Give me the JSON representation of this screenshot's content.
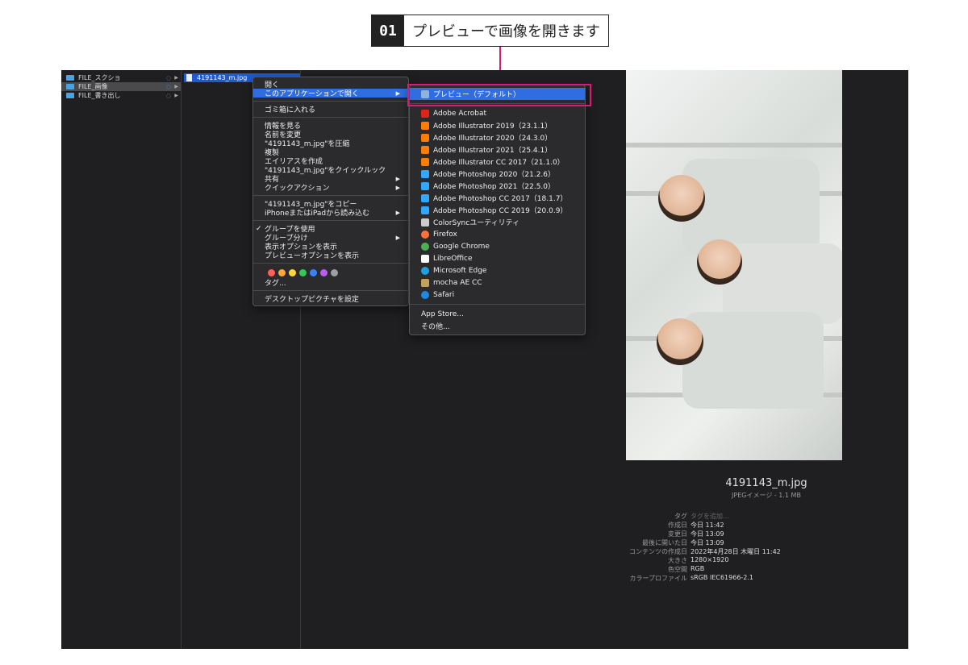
{
  "annotation": {
    "step_number": "01",
    "step_text": "プレビューで画像を開きます"
  },
  "sidebar": {
    "folders": [
      {
        "name": "FILE_スクショ",
        "selected": false
      },
      {
        "name": "FILE_画像",
        "selected": true
      },
      {
        "name": "FILE_書き出し",
        "selected": false
      }
    ]
  },
  "selected_file": {
    "name": "4191143_m.jpg"
  },
  "context_menu": {
    "open": "開く",
    "open_with": "このアプリケーションで開く",
    "trash": "ゴミ箱に入れる",
    "get_info": "情報を見る",
    "rename": "名前を変更",
    "compress": "\"4191143_m.jpg\"を圧縮",
    "duplicate": "複製",
    "alias": "エイリアスを作成",
    "quicklook": "\"4191143_m.jpg\"をクイックルック",
    "share": "共有",
    "quick_actions": "クイックアクション",
    "copy": "\"4191143_m.jpg\"をコピー",
    "import_iphone": "iPhoneまたはiPadから読み込む",
    "use_groups": "グループを使用",
    "group_by": "グループ分け",
    "view_options": "表示オプションを表示",
    "preview_options": "プレビューオプションを表示",
    "tag_colors": [
      "#ff5f57",
      "#ffa53b",
      "#ffd53b",
      "#35c759",
      "#3b82f6",
      "#bf5af2",
      "#9e9ea3"
    ],
    "tags": "タグ...",
    "desktop_picture": "デスクトップピクチャを設定"
  },
  "open_with_menu": {
    "apps": [
      {
        "label": "プレビュー（デフォルト）",
        "icon": "preview-icon",
        "color": "#8fb4d9",
        "active": true
      },
      {
        "label": "Adobe Acrobat",
        "icon": "acrobat-icon",
        "color": "#e2231a"
      },
      {
        "label": "Adobe Illustrator 2019（23.1.1）",
        "icon": "illustrator-icon",
        "color": "#ff7c00"
      },
      {
        "label": "Adobe Illustrator 2020（24.3.0）",
        "icon": "illustrator-icon",
        "color": "#ff7c00"
      },
      {
        "label": "Adobe Illustrator 2021（25.4.1）",
        "icon": "illustrator-icon",
        "color": "#ff7c00"
      },
      {
        "label": "Adobe Illustrator CC 2017（21.1.0）",
        "icon": "illustrator-icon",
        "color": "#ff7c00"
      },
      {
        "label": "Adobe Photoshop 2020（21.2.6）",
        "icon": "photoshop-icon",
        "color": "#31a8ff"
      },
      {
        "label": "Adobe Photoshop 2021（22.5.0）",
        "icon": "photoshop-icon",
        "color": "#31a8ff"
      },
      {
        "label": "Adobe Photoshop CC 2017（18.1.7）",
        "icon": "photoshop-icon",
        "color": "#31a8ff"
      },
      {
        "label": "Adobe Photoshop CC 2019（20.0.9）",
        "icon": "photoshop-icon",
        "color": "#31a8ff"
      },
      {
        "label": "ColorSyncユーティリティ",
        "icon": "colorsync-icon",
        "color": "#cccccc"
      },
      {
        "label": "Firefox",
        "icon": "firefox-icon",
        "color": "#ff7139"
      },
      {
        "label": "Google Chrome",
        "icon": "chrome-icon",
        "color": "#4caf50"
      },
      {
        "label": "LibreOffice",
        "icon": "libreoffice-icon",
        "color": "#ffffff"
      },
      {
        "label": "Microsoft Edge",
        "icon": "edge-icon",
        "color": "#1fa0e0"
      },
      {
        "label": "mocha AE CC",
        "icon": "mocha-icon",
        "color": "#c2a15b"
      },
      {
        "label": "Safari",
        "icon": "safari-icon",
        "color": "#1e88e5"
      }
    ],
    "app_store": "App Store...",
    "other": "その他..."
  },
  "preview": {
    "file_name": "4191143_m.jpg",
    "file_kind": "JPEGイメージ - 1.1 MB",
    "metadata": [
      {
        "key": "タグ",
        "value": "タグを追加...",
        "muted": true
      },
      {
        "key": "作成日",
        "value": "今日 11:42"
      },
      {
        "key": "変更日",
        "value": "今日 13:09"
      },
      {
        "key": "最後に開いた日",
        "value": "今日 13:09"
      },
      {
        "key": "コンテンツの作成日",
        "value": "2022年4月28日 木曜日 11:42"
      },
      {
        "key": "大きさ",
        "value": "1280×1920"
      },
      {
        "key": "色空間",
        "value": "RGB"
      },
      {
        "key": "カラープロファイル",
        "value": "sRGB IEC61966-2.1"
      }
    ]
  }
}
